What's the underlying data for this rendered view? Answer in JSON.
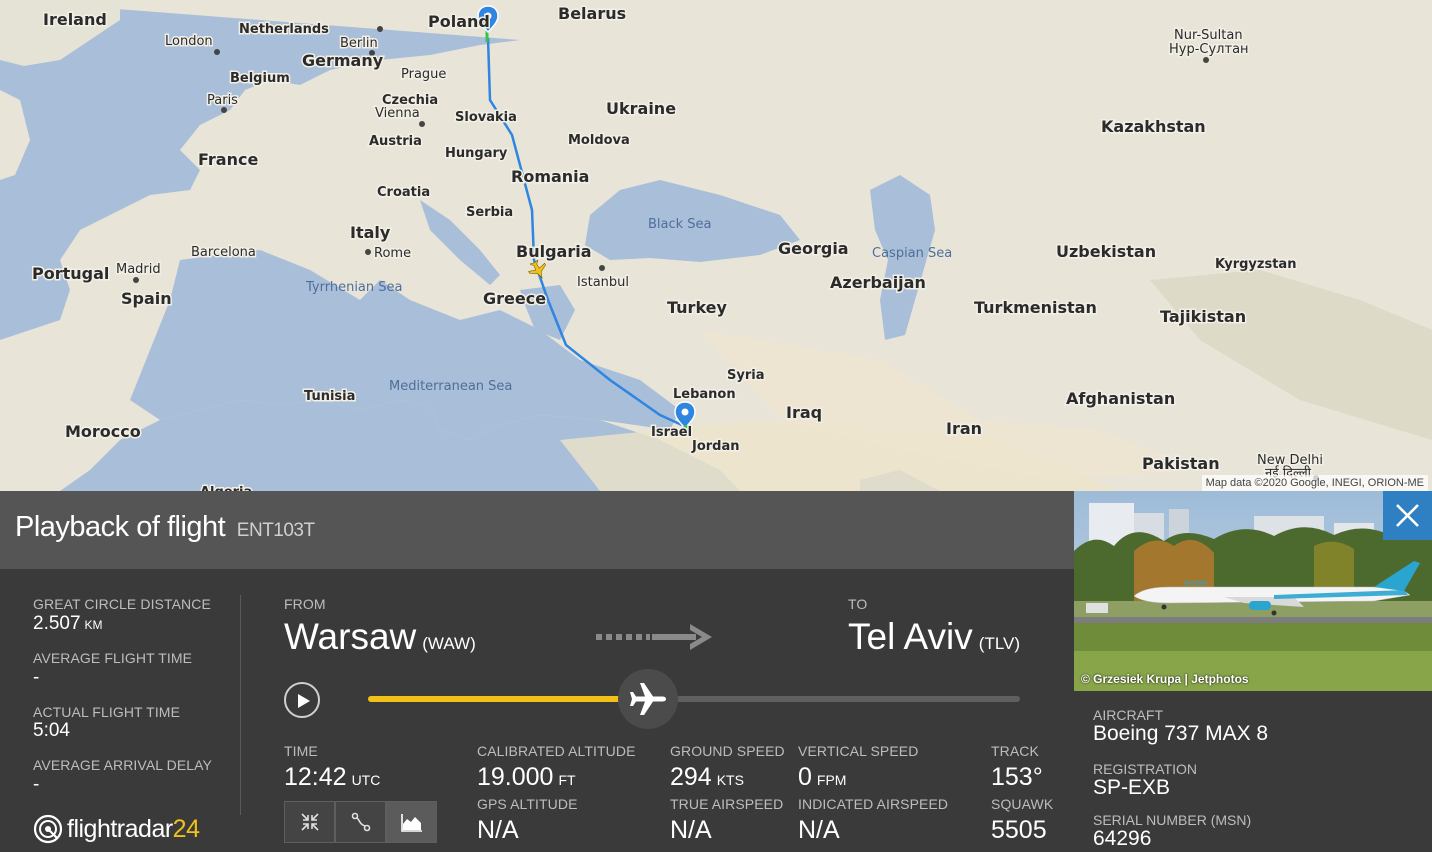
{
  "map": {
    "countries": [
      "Ireland",
      "Netherlands",
      "Poland",
      "Belarus",
      "Germany",
      "Belgium",
      "Czechia",
      "Ukraine",
      "Slovakia",
      "Austria",
      "Moldova",
      "Hungary",
      "France",
      "Romania",
      "Croatia",
      "Serbia",
      "Italy",
      "Bulgaria",
      "Georgia",
      "Portugal",
      "Spain",
      "Greece",
      "Azerbaijan",
      "Turkey",
      "Syria",
      "Lebanon",
      "Iraq",
      "Israel",
      "Jordan",
      "Iran",
      "Tunisia",
      "Morocco",
      "Kazakhstan",
      "Uzbekistan",
      "Kyrgyzstan",
      "Turkmenistan",
      "Tajikistan",
      "Afghanistan",
      "Pakistan",
      "Algeria"
    ],
    "cities": [
      "London",
      "Berlin",
      "Paris",
      "Prague",
      "Vienna",
      "Barcelona",
      "Madrid",
      "Rome",
      "Istanbul",
      "Nur-Sultan",
      "Нур-Султан",
      "New Delhi",
      "नई दिल्ली"
    ],
    "seas": [
      "Black Sea",
      "Caspian Sea",
      "Tyrrhenian Sea",
      "Mediterranean Sea"
    ],
    "attribution": "Map data ©2020 Google, INEGI, ORION-ME"
  },
  "panel": {
    "title": "Playback of flight",
    "callsign": "ENT103T",
    "stats": {
      "great_circle_label": "GREAT CIRCLE DISTANCE",
      "great_circle_value": "2.507",
      "great_circle_unit": "KM",
      "avg_flight_time_label": "AVERAGE FLIGHT TIME",
      "avg_flight_time_value": "-",
      "actual_flight_time_label": "ACTUAL FLIGHT TIME",
      "actual_flight_time_value": "5:04",
      "avg_arrival_delay_label": "AVERAGE ARRIVAL DELAY",
      "avg_arrival_delay_value": "-"
    },
    "route": {
      "from_label": "FROM",
      "from_city": "Warsaw",
      "from_code": "(WAW)",
      "to_label": "TO",
      "to_city": "Tel Aviv",
      "to_code": "(TLV)"
    },
    "playback_progress": 0.43,
    "telemetry": {
      "time_label": "TIME",
      "time_value": "12:42",
      "time_unit": "UTC",
      "cal_alt_label": "CALIBRATED ALTITUDE",
      "cal_alt_value": "19.000",
      "cal_alt_unit": "FT",
      "gps_alt_label": "GPS ALTITUDE",
      "gps_alt_value": "N/A",
      "ground_speed_label": "GROUND SPEED",
      "ground_speed_value": "294",
      "ground_speed_unit": "KTS",
      "true_airspeed_label": "TRUE AIRSPEED",
      "true_airspeed_value": "N/A",
      "vertical_speed_label": "VERTICAL SPEED",
      "vertical_speed_value": "0",
      "vertical_speed_unit": "FPM",
      "indicated_airspeed_label": "INDICATED AIRSPEED",
      "indicated_airspeed_value": "N/A",
      "track_label": "TRACK",
      "track_value": "153°",
      "squawk_label": "SQUAWK",
      "squawk_value": "5505"
    },
    "logo": {
      "text": "flightradar",
      "number": "24"
    }
  },
  "aircraft": {
    "photo_credit": "© Grzesiek Krupa | Jetphotos",
    "livery_text": "enter",
    "aircraft_label": "AIRCRAFT",
    "aircraft_value": "Boeing 737 MAX 8",
    "registration_label": "REGISTRATION",
    "registration_value": "SP-EXB",
    "msn_label": "SERIAL NUMBER (MSN)",
    "msn_value": "64296"
  },
  "colors": {
    "accent": "#f2c117",
    "route": "#2f86e0",
    "close": "#2f7fc3"
  },
  "icons": [
    "play-icon",
    "airplane-icon",
    "close-icon",
    "fit-view-icon",
    "route-icon",
    "altitude-graph-icon",
    "route-arrow-icon",
    "origin-pin-icon",
    "destination-pin-icon",
    "fr24-radar-icon"
  ]
}
